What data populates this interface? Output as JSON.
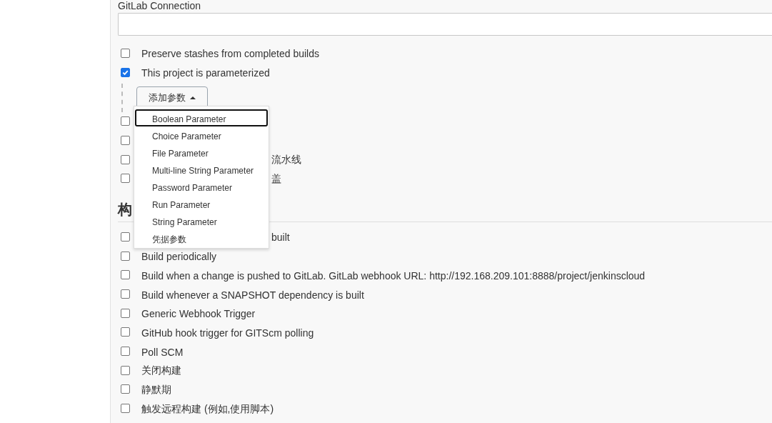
{
  "gitlab_connection": {
    "label": "GitLab Connection"
  },
  "options": [
    {
      "label": "Preserve stashes from completed builds",
      "checked": false
    },
    {
      "label": "This project is parameterized",
      "checked": true
    }
  ],
  "add_parameter": {
    "label": "添加参数",
    "expanded": true,
    "menu": [
      {
        "label": "Boolean Parameter",
        "selected": true
      },
      {
        "label": "Choice Parameter",
        "selected": false
      },
      {
        "label": "File Parameter",
        "selected": false
      },
      {
        "label": "Multi-line String Parameter",
        "selected": false
      },
      {
        "label": "Password Parameter",
        "selected": false
      },
      {
        "label": "Run Parameter",
        "selected": false
      },
      {
        "label": "String Parameter",
        "selected": false
      },
      {
        "label": "凭据参数",
        "selected": false
      }
    ]
  },
  "covered_options": [
    {
      "checked": false
    },
    {
      "checked": false
    },
    {
      "checked": false,
      "visible_text": "流水线"
    },
    {
      "checked": false,
      "visible_text": "盖"
    }
  ],
  "build_triggers": {
    "heading": "构",
    "options": [
      {
        "visible_text": "built",
        "checked": false
      },
      {
        "label": "Build periodically",
        "checked": false
      },
      {
        "label": "Build when a change is pushed to GitLab. GitLab webhook URL: http://192.168.209.101:8888/project/jenkinscloud",
        "checked": false
      },
      {
        "label": "Build whenever a SNAPSHOT dependency is built",
        "checked": false
      },
      {
        "label": "Generic Webhook Trigger",
        "checked": false
      },
      {
        "label": "GitHub hook trigger for GITScm polling",
        "checked": false
      },
      {
        "label": "Poll SCM",
        "checked": false
      },
      {
        "label": "关闭构建",
        "checked": false
      },
      {
        "label": "静默期",
        "checked": false
      },
      {
        "label": "触发远程构建 (例如,使用脚本)",
        "checked": false
      }
    ]
  }
}
